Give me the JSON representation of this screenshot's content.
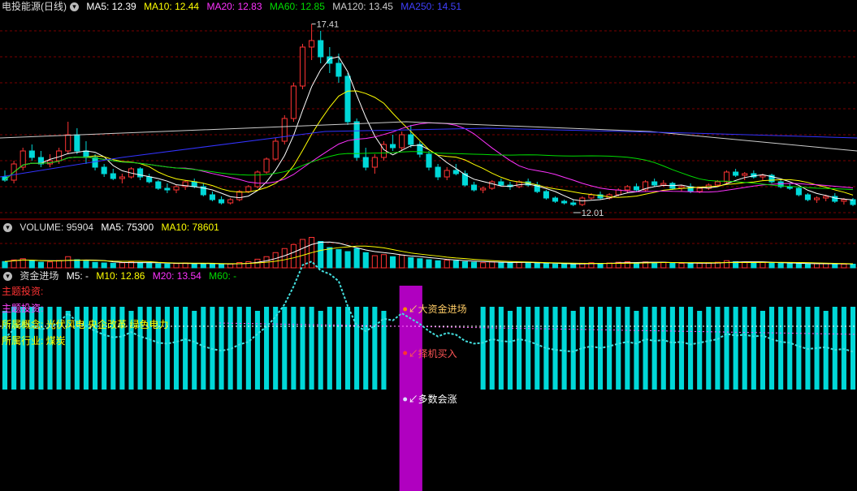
{
  "colors": {
    "bg": "#000000",
    "up": "#ff3333",
    "down": "#00d8d8",
    "grid": "#7a0000",
    "ma5": "#ffffff",
    "ma10": "#ffff00",
    "ma20": "#ff33ff",
    "ma60": "#00dd00",
    "ma120": "#cccccc",
    "ma250": "#3333ff",
    "zone": "#b000c0"
  },
  "header_price": {
    "title": "电投能源(日线)",
    "ma5": "MA5: 12.39",
    "ma10": "MA10: 12.44",
    "ma20": "MA20: 12.83",
    "ma60": "MA60: 12.85",
    "ma120": "MA120: 13.45",
    "ma250": "MA250: 14.51"
  },
  "header_volume": {
    "title": "VOLUME: 95904",
    "ma5": "MA5: 75300",
    "ma10": "MA10: 78601"
  },
  "header_fund": {
    "title": "资金进场",
    "m5": "M5: -",
    "m10": "M10: 12.86",
    "m20": "M20: 13.54",
    "m60": "M60: -"
  },
  "info": {
    "theme": "主题投资:",
    "sub": "主题投资:",
    "concept": "所属概念: 光伏风电 央企改革 绿色电力",
    "industry": "所属行业: 煤炭"
  },
  "annotations": {
    "high": "17.41",
    "low": "12.01",
    "big_fund": "↙大资金进场",
    "buy": "↙择机买入",
    "most_up": "↙多数会涨"
  },
  "chart_data": {
    "type": "candlestick",
    "title": "电投能源(日线)",
    "price_range": [
      11.6,
      17.7
    ],
    "candles": [
      [
        12.7,
        12.9,
        12.55,
        12.6
      ],
      [
        12.6,
        13.2,
        12.5,
        13.1
      ],
      [
        13.0,
        13.6,
        12.9,
        13.5
      ],
      [
        13.5,
        13.7,
        13.2,
        13.3
      ],
      [
        13.3,
        13.5,
        13.0,
        13.1
      ],
      [
        13.1,
        13.4,
        13.0,
        13.2
      ],
      [
        13.2,
        13.6,
        13.1,
        13.5
      ],
      [
        13.5,
        14.4,
        13.4,
        14.0
      ],
      [
        14.0,
        14.2,
        13.4,
        13.5
      ],
      [
        13.5,
        13.8,
        13.1,
        13.3
      ],
      [
        13.3,
        13.4,
        12.9,
        13.0
      ],
      [
        13.0,
        13.1,
        12.7,
        12.8
      ],
      [
        12.8,
        12.95,
        12.6,
        12.65
      ],
      [
        12.65,
        12.8,
        12.5,
        12.7
      ],
      [
        12.7,
        13.0,
        12.65,
        12.95
      ],
      [
        12.95,
        13.0,
        12.6,
        12.7
      ],
      [
        12.7,
        12.8,
        12.5,
        12.55
      ],
      [
        12.55,
        12.6,
        12.3,
        12.35
      ],
      [
        12.35,
        12.5,
        12.2,
        12.3
      ],
      [
        12.3,
        12.45,
        12.2,
        12.4
      ],
      [
        12.4,
        12.6,
        12.3,
        12.55
      ],
      [
        12.55,
        12.65,
        12.35,
        12.4
      ],
      [
        12.4,
        12.5,
        12.1,
        12.15
      ],
      [
        12.15,
        12.25,
        11.95,
        12.0
      ],
      [
        12.0,
        12.1,
        11.85,
        11.9
      ],
      [
        11.9,
        12.05,
        11.85,
        12.0
      ],
      [
        12.0,
        12.3,
        11.95,
        12.25
      ],
      [
        12.25,
        12.45,
        12.2,
        12.4
      ],
      [
        12.4,
        12.9,
        12.35,
        12.85
      ],
      [
        12.85,
        13.3,
        12.8,
        13.25
      ],
      [
        13.25,
        13.9,
        13.2,
        13.8
      ],
      [
        13.8,
        14.6,
        13.7,
        14.5
      ],
      [
        14.5,
        15.6,
        14.4,
        15.5
      ],
      [
        15.5,
        16.8,
        15.4,
        16.7
      ],
      [
        16.7,
        17.41,
        16.3,
        16.9
      ],
      [
        16.9,
        17.2,
        16.2,
        16.4
      ],
      [
        16.4,
        16.7,
        15.9,
        16.2
      ],
      [
        16.2,
        16.5,
        15.6,
        15.8
      ],
      [
        15.8,
        15.9,
        14.3,
        14.4
      ],
      [
        14.4,
        14.5,
        13.2,
        13.3
      ],
      [
        13.3,
        13.6,
        12.9,
        13.0
      ],
      [
        13.0,
        13.4,
        12.8,
        13.3
      ],
      [
        13.3,
        13.8,
        13.2,
        13.7
      ],
      [
        13.7,
        14.0,
        13.5,
        13.6
      ],
      [
        13.6,
        14.1,
        13.5,
        14.0
      ],
      [
        14.0,
        14.3,
        13.6,
        13.7
      ],
      [
        13.7,
        13.8,
        13.3,
        13.4
      ],
      [
        13.4,
        13.5,
        12.9,
        13.0
      ],
      [
        13.0,
        13.1,
        12.6,
        12.7
      ],
      [
        12.7,
        13.0,
        12.6,
        12.9
      ],
      [
        12.9,
        13.1,
        12.75,
        12.8
      ],
      [
        12.8,
        12.9,
        12.4,
        12.45
      ],
      [
        12.45,
        12.55,
        12.25,
        12.3
      ],
      [
        12.3,
        12.4,
        12.2,
        12.35
      ],
      [
        12.35,
        12.6,
        12.3,
        12.55
      ],
      [
        12.55,
        12.65,
        12.4,
        12.45
      ],
      [
        12.45,
        12.55,
        12.3,
        12.4
      ],
      [
        12.4,
        12.6,
        12.35,
        12.55
      ],
      [
        12.55,
        12.65,
        12.4,
        12.45
      ],
      [
        12.45,
        12.55,
        12.2,
        12.25
      ],
      [
        12.25,
        12.3,
        12.0,
        12.05
      ],
      [
        12.05,
        12.1,
        11.9,
        11.95
      ],
      [
        11.95,
        12.0,
        11.85,
        11.9
      ],
      [
        11.9,
        12.0,
        11.8,
        11.85
      ],
      [
        11.85,
        12.1,
        11.8,
        12.05
      ],
      [
        12.05,
        12.2,
        12.0,
        12.15
      ],
      [
        12.15,
        12.25,
        12.0,
        12.05
      ],
      [
        12.05,
        12.2,
        12.0,
        12.15
      ],
      [
        12.15,
        12.35,
        12.1,
        12.3
      ],
      [
        12.3,
        12.45,
        12.2,
        12.4
      ],
      [
        12.4,
        12.5,
        12.25,
        12.3
      ],
      [
        12.3,
        12.6,
        12.25,
        12.55
      ],
      [
        12.55,
        12.65,
        12.4,
        12.45
      ],
      [
        12.45,
        12.6,
        12.4,
        12.5
      ],
      [
        12.5,
        12.55,
        12.3,
        12.35
      ],
      [
        12.35,
        12.45,
        12.25,
        12.4
      ],
      [
        12.4,
        12.5,
        12.2,
        12.25
      ],
      [
        12.25,
        12.4,
        12.2,
        12.35
      ],
      [
        12.35,
        12.5,
        12.3,
        12.45
      ],
      [
        12.45,
        12.6,
        12.4,
        12.55
      ],
      [
        12.55,
        12.9,
        12.5,
        12.85
      ],
      [
        12.85,
        12.95,
        12.7,
        12.75
      ],
      [
        12.75,
        12.85,
        12.6,
        12.8
      ],
      [
        12.8,
        12.9,
        12.65,
        12.7
      ],
      [
        12.7,
        12.8,
        12.6,
        12.75
      ],
      [
        12.75,
        12.8,
        12.5,
        12.55
      ],
      [
        12.55,
        12.6,
        12.35,
        12.4
      ],
      [
        12.4,
        12.5,
        12.3,
        12.35
      ],
      [
        12.35,
        12.4,
        12.1,
        12.15
      ],
      [
        12.15,
        12.2,
        11.95,
        12.0
      ],
      [
        12.0,
        12.1,
        11.9,
        12.05
      ],
      [
        12.05,
        12.15,
        11.95,
        12.1
      ],
      [
        12.1,
        12.2,
        11.9,
        11.95
      ],
      [
        11.95,
        12.05,
        11.85,
        12.0
      ],
      [
        12.0,
        12.05,
        11.8,
        11.85
      ]
    ],
    "volume": [
      62,
      78,
      90,
      70,
      55,
      58,
      72,
      110,
      80,
      66,
      54,
      48,
      45,
      50,
      60,
      52,
      46,
      40,
      38,
      42,
      48,
      44,
      40,
      36,
      34,
      38,
      52,
      60,
      85,
      110,
      150,
      190,
      230,
      280,
      300,
      260,
      200,
      180,
      160,
      190,
      150,
      120,
      130,
      110,
      125,
      100,
      90,
      80,
      70,
      75,
      68,
      60,
      55,
      50,
      58,
      52,
      48,
      55,
      50,
      45,
      40,
      38,
      36,
      35,
      45,
      50,
      44,
      48,
      55,
      60,
      52,
      58,
      50,
      54,
      46,
      44,
      42,
      45,
      50,
      55,
      70,
      60,
      58,
      52,
      55,
      48,
      44,
      42,
      40,
      38,
      40,
      42,
      38,
      36,
      36
    ],
    "zones": [
      [
        44,
        46
      ],
      [
        166,
        168
      ]
    ]
  }
}
